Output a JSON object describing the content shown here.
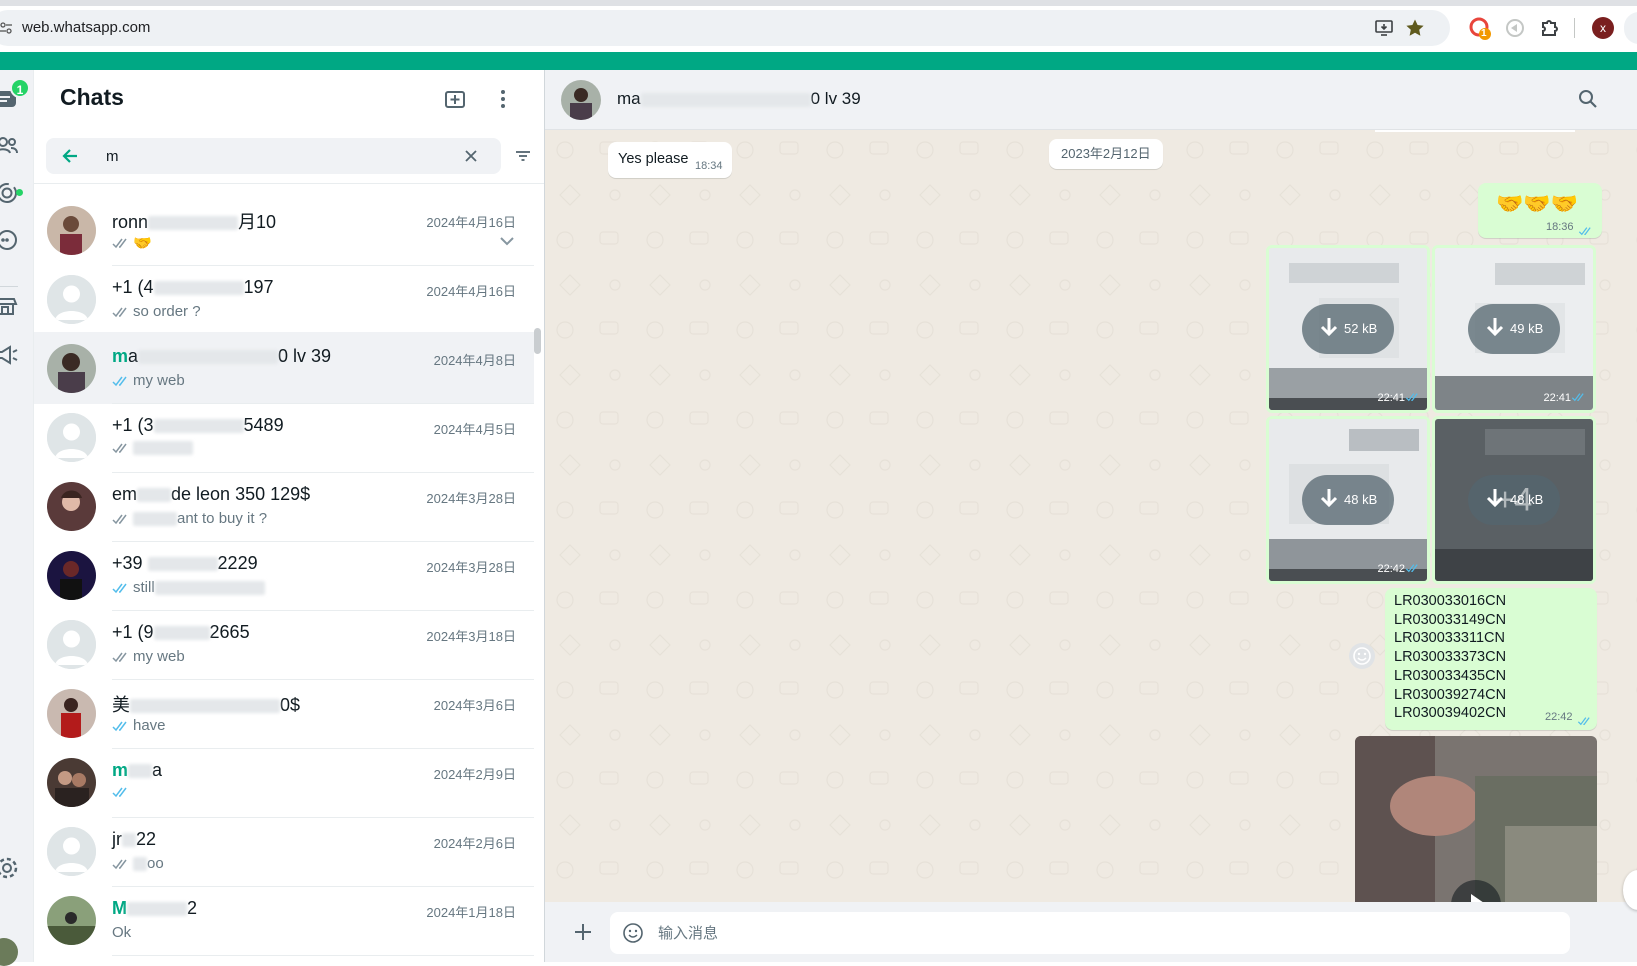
{
  "browser": {
    "url": "web.whatsapp.com",
    "profile_initial": "x",
    "extension_badge": "1"
  },
  "rail": {
    "chats_badge": "1",
    "icons": [
      "chats-icon",
      "contacts-icon",
      "status-icon",
      "channels-icon",
      "store-icon",
      "broadcast-icon",
      "settings-icon"
    ]
  },
  "list": {
    "title": "Chats",
    "search": {
      "value": "m",
      "placeholder": ""
    }
  },
  "chats": [
    {
      "name_hl": "",
      "name": "ronn",
      "name_tail": "月10",
      "date": "2024年4月16日",
      "preview": "🤝",
      "tick": "grey",
      "active": false,
      "avatar": "photo1"
    },
    {
      "name_hl": "",
      "name": "+1 (4",
      "name_tail": "197",
      "date": "2024年4月16日",
      "preview": "so order ?",
      "tick": "grey",
      "active": false,
      "avatar": "default"
    },
    {
      "name_hl": "m",
      "name": "a",
      "name_tail": "0 lv 39",
      "date": "2024年4月8日",
      "preview": "my web",
      "tick": "blue",
      "active": true,
      "avatar": "photo2"
    },
    {
      "name_hl": "",
      "name": "+1 (3",
      "name_tail": "5489",
      "date": "2024年4月5日",
      "preview": "",
      "tick": "grey",
      "active": false,
      "avatar": "default"
    },
    {
      "name_hl": "",
      "name": "em",
      "name_tail": "de leon 350 129$",
      "date": "2024年3月28日",
      "preview": "ant to buy it ?",
      "tick": "grey",
      "active": false,
      "avatar": "photo3"
    },
    {
      "name_hl": "",
      "name": "+39 ",
      "name_tail": "2229",
      "date": "2024年3月28日",
      "preview": "still",
      "tick": "blue",
      "active": false,
      "avatar": "photo4"
    },
    {
      "name_hl": "",
      "name": "+1 (9",
      "name_tail": "2665",
      "date": "2024年3月18日",
      "preview": "my web",
      "tick": "grey",
      "active": false,
      "avatar": "default"
    },
    {
      "name_hl": "",
      "name": "美",
      "name_tail": "0$",
      "date": "2024年3月6日",
      "preview": "have",
      "tick": "blue",
      "active": false,
      "avatar": "photo5"
    },
    {
      "name_hl": "m",
      "name": "",
      "name_tail": "a",
      "date": "2024年2月9日",
      "preview": "",
      "tick": "blue",
      "active": false,
      "avatar": "photo6"
    },
    {
      "name_hl": "",
      "name": "jr",
      "name_tail": "22",
      "date": "2024年2月6日",
      "preview": "oo",
      "tick": "grey",
      "active": false,
      "avatar": "default"
    },
    {
      "name_hl": "M",
      "name": "",
      "name_tail": "2",
      "date": "2024年1月18日",
      "preview": "Ok",
      "tick": "",
      "active": false,
      "avatar": "photo7"
    }
  ],
  "conversation": {
    "name_start": "ma",
    "name_end": "0 lv 39",
    "date_chip": "2023年2月12日",
    "incoming": {
      "text": "Yes please",
      "time": "18:34"
    },
    "emoji_msg": {
      "text": "🤝🤝🤝",
      "time": "18:36"
    },
    "media": [
      {
        "size": "52 kB",
        "time": "22:41"
      },
      {
        "size": "49 kB",
        "time": "22:41"
      },
      {
        "size": "48 kB",
        "time": "22:42"
      },
      {
        "size": "48 kB",
        "time": "",
        "more": "+4"
      }
    ],
    "tracking": {
      "lines": [
        "LR030033016CN",
        "LR030033149CN",
        "LR030033311CN",
        "LR030033373CN",
        "LR030033435CN",
        "LR030039274CN",
        "LR030039402CN"
      ],
      "time": "22:42"
    },
    "composer_placeholder": "输入消息"
  },
  "colors": {
    "accent": "#00a884",
    "outgoing_bubble": "#d9fdd3",
    "chat_bg": "#efeae2",
    "read_tick": "#53bdeb"
  }
}
